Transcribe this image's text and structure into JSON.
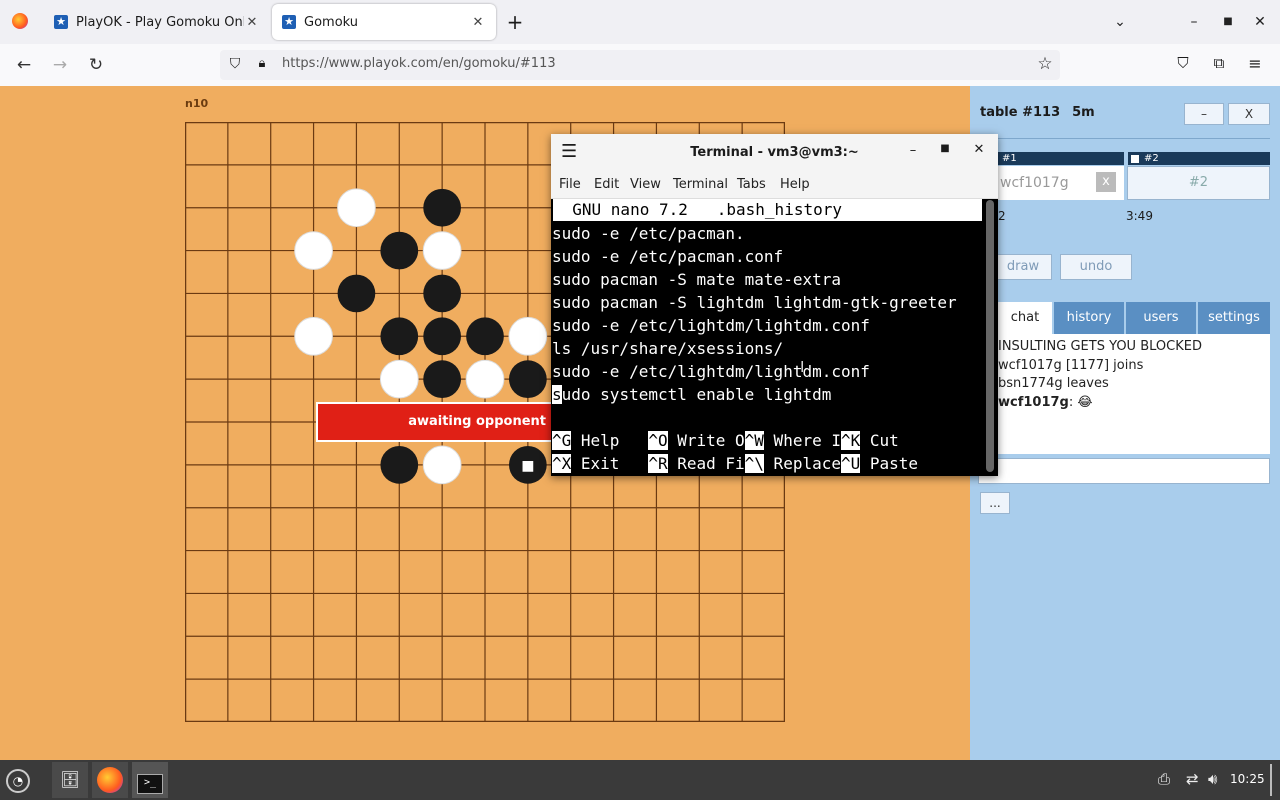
{
  "browser": {
    "tabs": [
      {
        "title": "PlayOK - Play Gomoku Online"
      },
      {
        "title": "Gomoku"
      }
    ],
    "new_tab": "+",
    "url_host": "https://www.playok.com",
    "url_path": "/en/gomoku/#113"
  },
  "game": {
    "coord": "n10",
    "banner": "awaiting opponent",
    "stones": {
      "white": [
        [
          4,
          2
        ],
        [
          3,
          3
        ],
        [
          6,
          3
        ],
        [
          3,
          5
        ],
        [
          8,
          5
        ],
        [
          5,
          6
        ],
        [
          7,
          6
        ],
        [
          6,
          8
        ]
      ],
      "black": [
        [
          6,
          2
        ],
        [
          5,
          3
        ],
        [
          4,
          4
        ],
        [
          6,
          4
        ],
        [
          5,
          5
        ],
        [
          6,
          5
        ],
        [
          7,
          5
        ],
        [
          6,
          6
        ],
        [
          8,
          6
        ],
        [
          5,
          8
        ],
        [
          8,
          8
        ]
      ]
    },
    "last_move_marker": "■"
  },
  "side": {
    "table_title": "table #113",
    "time_control": "5m",
    "minimize": "–",
    "close": "X",
    "p1": {
      "label": "#1",
      "name": "wcf1017g",
      "clear": "x",
      "score": "2"
    },
    "p2": {
      "label": "#2",
      "seat": "#2",
      "time": "3:49"
    },
    "draw": "draw",
    "undo": "undo",
    "tabs": [
      "chat",
      "history",
      "users",
      "settings"
    ],
    "chat": [
      "INSULTING GETS YOU BLOCKED",
      "wcf1017g [1177] joins",
      "bsn1774g leaves"
    ],
    "chat_last_user": "wcf1017g",
    "chat_last_msg": "😂",
    "more": "..."
  },
  "terminal": {
    "title": "Terminal - vm3@vm3:~",
    "menu": [
      "File",
      "Edit",
      "View",
      "Terminal",
      "Tabs",
      "Help"
    ],
    "nano_header": "  GNU nano 7.2   .bash_history",
    "lines": [
      "sudo -e /etc/pacman.",
      "sudo -e /etc/pacman.conf",
      "sudo pacman -S mate mate-extra",
      "sudo pacman -S lightdm lightdm-gtk-greeter",
      "sudo -e /etc/lightdm/lightdm.conf",
      "ls /usr/share/xsessions/",
      "sudo -e /etc/lightdm/lightdm.conf"
    ],
    "cursor_char": "s",
    "cursor_rest": "udo systemctl enable lightdm",
    "shortcuts_row1": [
      [
        "^G",
        " Help   "
      ],
      [
        "^O",
        " Write O"
      ],
      [
        "^W",
        " Where I"
      ],
      [
        "^K",
        " Cut"
      ]
    ],
    "shortcuts_row2": [
      [
        "^X",
        " Exit   "
      ],
      [
        "^R",
        " Read Fi"
      ],
      [
        "^\\",
        " Replace"
      ],
      [
        "^U",
        " Paste"
      ]
    ]
  },
  "taskbar": {
    "clock": "10:25"
  }
}
